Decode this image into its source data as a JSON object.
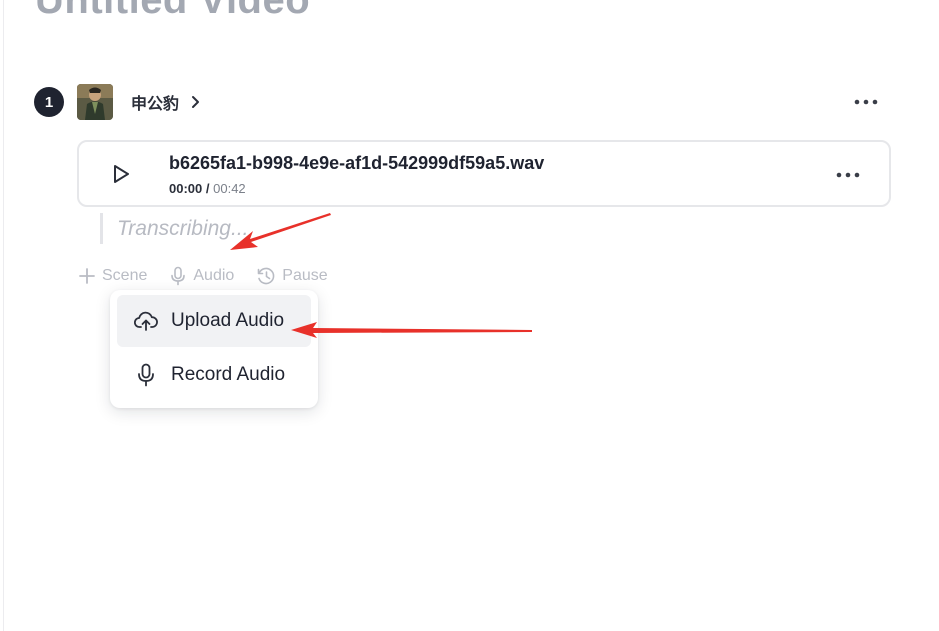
{
  "video": {
    "title": "Untitled Video"
  },
  "scene": {
    "number": "1",
    "speaker_name": "申公豹"
  },
  "audio_card": {
    "file_name": "b6265fa1-b998-4e9e-af1d-542999df59a5.wav",
    "current_time": "00:00",
    "separator": "/",
    "total_time": "00:42"
  },
  "transcript": {
    "status_text": "Transcribing..."
  },
  "actions": {
    "scene_label": "Scene",
    "audio_label": "Audio",
    "pause_label": "Pause"
  },
  "audio_menu": {
    "items": [
      {
        "label": "Upload Audio",
        "icon": "cloud-upload-icon"
      },
      {
        "label": "Record Audio",
        "icon": "microphone-icon"
      }
    ]
  },
  "colors": {
    "annotation_arrow": "#e8312a",
    "muted_text": "#b9bcc4",
    "primary_text": "#1f2330"
  }
}
